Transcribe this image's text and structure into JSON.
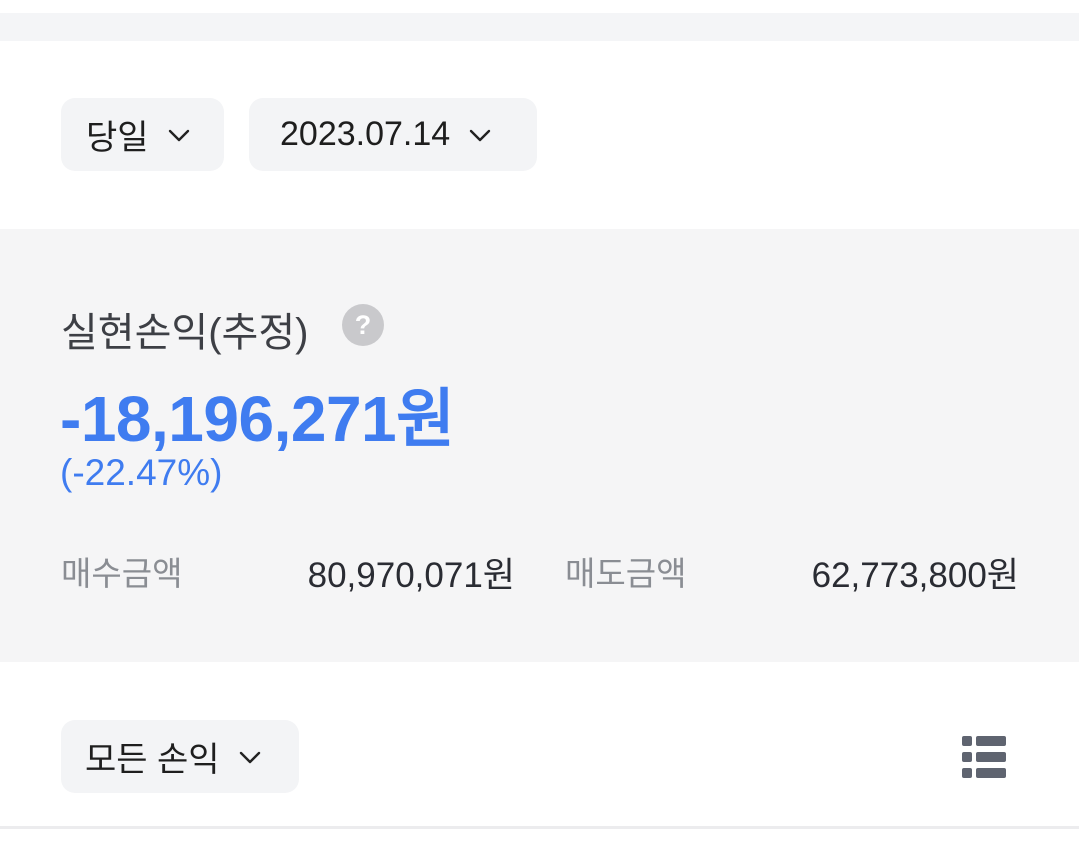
{
  "filters": {
    "period": {
      "label": "당일",
      "icon": "chevron-down-icon"
    },
    "date": {
      "label": "2023.07.14",
      "icon": "chevron-down-icon"
    }
  },
  "summary": {
    "title": "실현손익(추정)",
    "help_icon": "?",
    "pnl_amount": "-18,196,271원",
    "pnl_rate": "(-22.47%)",
    "buy_label": "매수금액",
    "buy_value": "80,970,071원",
    "sell_label": "매도금액",
    "sell_value": "62,773,800원"
  },
  "list_controls": {
    "filter_label": "모든 손익",
    "view_icon": "list-view-icon"
  },
  "colors": {
    "accent": "#3f7cf0",
    "panel_bg": "#f5f5f6",
    "chip_bg": "#f3f4f6",
    "muted_text": "#8a8d93",
    "help_icon_bg": "#c9c9cc"
  }
}
